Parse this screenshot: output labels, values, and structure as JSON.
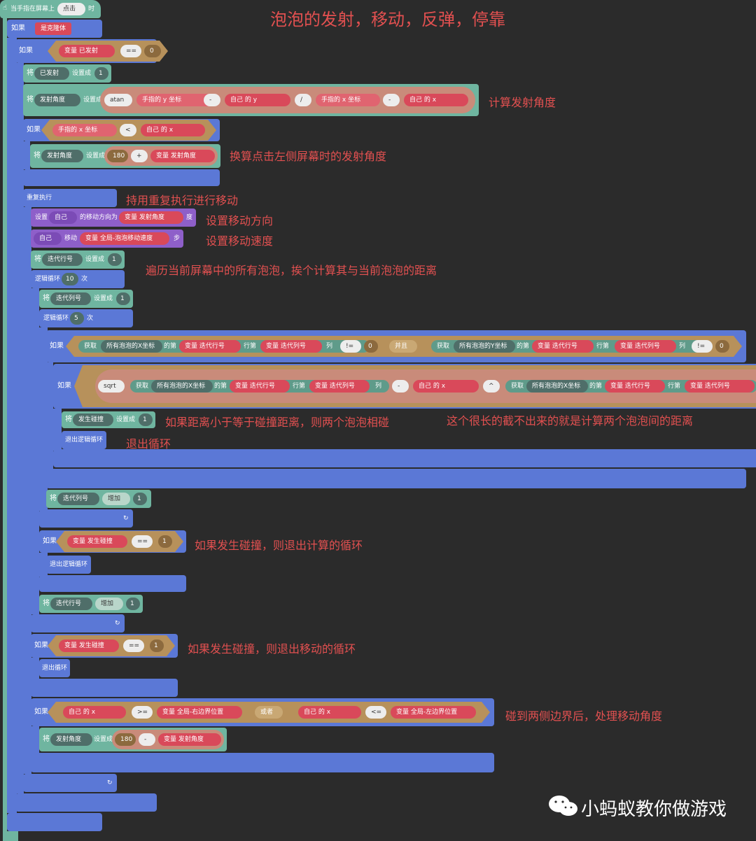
{
  "title": "泡泡的发射，移动，反弹，停靠",
  "hat": {
    "label": "当手指在屏幕上",
    "event": "点击",
    "suffix": "时"
  },
  "kw": {
    "if": "如果",
    "set": "将",
    "set_to": "设置成",
    "repeat": "重复执行",
    "loop": "逻辑循环",
    "times": "次",
    "exit_loop": "退出逻辑循环",
    "exit": "退出循环",
    "and": "并且",
    "or": "或者",
    "of": "的",
    "var": "变量",
    "get": "获取",
    "set_dir_prefix": "设置",
    "set_dir_mid": "的移动方向为",
    "degree": "度",
    "move": "移动",
    "step": "步",
    "row": "行第",
    "col": "列",
    "at": "的第",
    "inc": "增加",
    "coord": "坐标",
    "finger": "手指的"
  },
  "blocks": {
    "is_clone": "是克隆体",
    "fired": "已发射",
    "eq": "==",
    "zero": "0",
    "one": "1",
    "angle": "发射角度",
    "atan": "atan",
    "y": "y",
    "x": "x",
    "minus": "-",
    "div": "/",
    "self": "自己",
    "lt": "<",
    "plus": "+",
    "n180": "180",
    "self2": "自己",
    "speed": "全局-泡泡移动速度",
    "row_var": "迭代行号",
    "col_var": "迭代列号",
    "n10": "10",
    "n5": "5",
    "allx": "所有泡泡的X坐标",
    "ally": "所有泡泡的Y坐标",
    "neq": "!=",
    "sqrt": "sqrt",
    "pow": "^",
    "collide": "发生碰撞",
    "ge": ">=",
    "le": "<=",
    "right_bound": "全局-右边界位置",
    "left_bound": "全局-左边界位置"
  },
  "notes": {
    "calc_angle": "计算发射角度",
    "left_side": "换算点击左侧屏幕时的发射角度",
    "repeat_move": "持用重复执行进行移动",
    "set_dir": "设置移动方向",
    "set_speed": "设置移动速度",
    "traverse": "遍历当前屏幕中的所有泡泡，挨个计算其与当前泡泡的距离",
    "collide": "如果距离小于等于碰撞距离，则两个泡泡相碰",
    "long_expr": "这个很长的截不出来的就是计算两个泡泡间的距离",
    "exit_loop": "退出循环",
    "exit_calc": "如果发生碰撞，则退出计算的循环",
    "exit_move": "如果发生碰撞，则退出移动的循环",
    "bounce": "碰到两侧边界后，处理移动角度"
  },
  "watermark": "小蚂蚁教你做游戏",
  "colors": {
    "control": "#5b78d6",
    "condition": "#d0a468",
    "data": "#6fb5a0",
    "motion": "#8e5fc9",
    "note": "#e25050"
  }
}
